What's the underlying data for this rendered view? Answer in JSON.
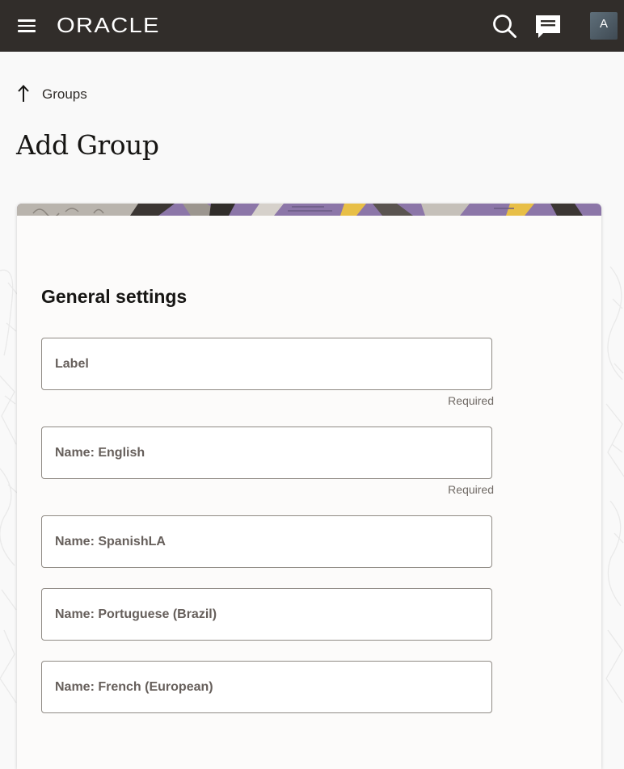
{
  "header": {
    "logo_text": "ORACLE",
    "avatar_initial": "A",
    "icons": [
      "menu-icon",
      "search-icon",
      "chat-icon"
    ]
  },
  "breadcrumb": {
    "label": "Groups"
  },
  "page": {
    "title": "Add Group"
  },
  "form": {
    "section_title": "General settings",
    "required_text": "Required",
    "fields": [
      {
        "label": "Label",
        "value": "",
        "required": true
      },
      {
        "label": "Name: English",
        "value": "",
        "required": true
      },
      {
        "label": "Name: SpanishLA",
        "value": "",
        "required": false
      },
      {
        "label": "Name: Portuguese (Brazil)",
        "value": "",
        "required": false
      },
      {
        "label": "Name: French (European)",
        "value": "",
        "required": false
      }
    ]
  },
  "colors": {
    "header_bg": "#312d2a",
    "page_bg": "#f9f9f9",
    "card_bg": "#fcfbfa",
    "banner_purple": "#8c76a8",
    "banner_yellow": "#e8bf47"
  }
}
